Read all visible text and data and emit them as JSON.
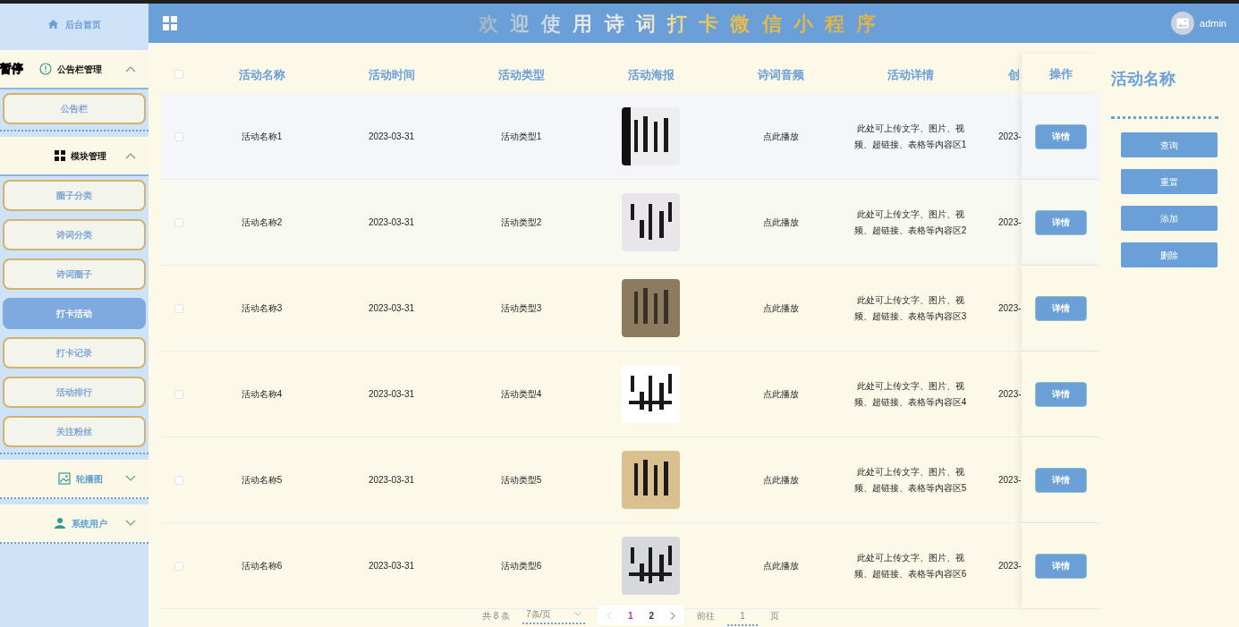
{
  "sidebar": {
    "items": [
      {
        "kind": "link",
        "label": "后台首页",
        "selected": false
      },
      {
        "kind": "group",
        "label": "公告栏管理",
        "expanded": true,
        "children": [
          {
            "label": "公告栏",
            "selected": false
          }
        ]
      },
      {
        "kind": "group",
        "label": "模块管理",
        "expanded": true,
        "children": [
          {
            "label": "圈子分类",
            "selected": false
          },
          {
            "label": "诗词分类",
            "selected": false
          },
          {
            "label": "诗词圈子",
            "selected": false
          },
          {
            "label": "打卡活动",
            "selected": true
          },
          {
            "label": "打卡记录",
            "selected": false
          },
          {
            "label": "活动排行",
            "selected": false
          },
          {
            "label": "关注粉丝",
            "selected": false
          }
        ]
      },
      {
        "kind": "group",
        "label": "轮播图",
        "expanded": false
      },
      {
        "kind": "group",
        "label": "系统用户",
        "expanded": false
      }
    ]
  },
  "overlay_text": "暂停",
  "header": {
    "title": "欢迎使用诗词打卡微信小程序",
    "user": "admin"
  },
  "table": {
    "select_all": {
      "checked": false
    },
    "columns": [
      "活动名称",
      "活动时间",
      "活动类型",
      "活动海报",
      "诗词音频",
      "活动详情",
      "创",
      "操作"
    ],
    "rows": [
      {
        "checked": false,
        "name": "活动名称1",
        "time": "2023-03-31",
        "type": "活动类型1",
        "audio": "点此播放",
        "detail": "此处可上传文字、图片、视频、超链接、表格等内容区1",
        "created": "2023-",
        "action": "详情"
      },
      {
        "checked": false,
        "name": "活动名称2",
        "time": "2023-03-31",
        "type": "活动类型2",
        "audio": "点此播放",
        "detail": "此处可上传文字、图片、视频、超链接、表格等内容区2",
        "created": "2023-",
        "action": "详情"
      },
      {
        "checked": false,
        "name": "活动名称3",
        "time": "2023-03-31",
        "type": "活动类型3",
        "audio": "点此播放",
        "detail": "此处可上传文字、图片、视频、超链接、表格等内容区3",
        "created": "2023-",
        "action": "详情"
      },
      {
        "checked": false,
        "name": "活动名称4",
        "time": "2023-03-31",
        "type": "活动类型4",
        "audio": "点此播放",
        "detail": "此处可上传文字、图片、视频、超链接、表格等内容区4",
        "created": "2023-",
        "action": "详情"
      },
      {
        "checked": false,
        "name": "活动名称5",
        "time": "2023-03-31",
        "type": "活动类型5",
        "audio": "点此播放",
        "detail": "此处可上传文字、图片、视频、超链接、表格等内容区5",
        "created": "2023-",
        "action": "详情"
      },
      {
        "checked": false,
        "name": "活动名称6",
        "time": "2023-03-31",
        "type": "活动类型6",
        "audio": "点此播放",
        "detail": "此处可上传文字、图片、视频、超链接、表格等内容区6",
        "created": "2023-",
        "action": "详情"
      }
    ]
  },
  "pagination": {
    "total": "共 8 条",
    "page_size": "7条/页",
    "pages": [
      {
        "label": "1",
        "selected": true
      },
      {
        "label": "2",
        "selected": false
      }
    ],
    "goto_label": "前往",
    "goto_value": "1",
    "page_suffix": "页"
  },
  "search_panel": {
    "title": "活动名称",
    "buttons": [
      "查询",
      "重置",
      "添加",
      "删除"
    ]
  }
}
